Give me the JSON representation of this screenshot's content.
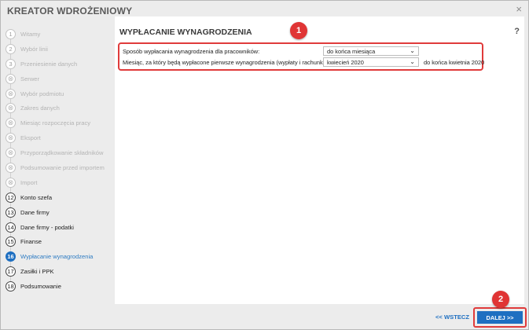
{
  "app": {
    "title": "KREATOR WDROŻENIOWY",
    "close": "×"
  },
  "steps": [
    {
      "num": "1",
      "label": "Witamy",
      "state": "done"
    },
    {
      "num": "2",
      "label": "Wybór linii",
      "state": "done"
    },
    {
      "num": "3",
      "label": "Przeniesienie danych",
      "state": "done"
    },
    {
      "num": "⊗",
      "label": "Serwer",
      "state": "skipped"
    },
    {
      "num": "⊗",
      "label": "Wybór podmiotu",
      "state": "skipped"
    },
    {
      "num": "⊗",
      "label": "Zakres danych",
      "state": "skipped"
    },
    {
      "num": "⊗",
      "label": "Miesiąc rozpoczęcia pracy",
      "state": "skipped"
    },
    {
      "num": "⊗",
      "label": "Eksport",
      "state": "skipped"
    },
    {
      "num": "⊗",
      "label": "Przyporządkowanie składników",
      "state": "skipped"
    },
    {
      "num": "⊗",
      "label": "Podsumowanie przed importem",
      "state": "skipped"
    },
    {
      "num": "⊗",
      "label": "Import",
      "state": "skipped"
    },
    {
      "num": "12",
      "label": "Konto szefa",
      "state": "active"
    },
    {
      "num": "13",
      "label": "Dane firmy",
      "state": "active"
    },
    {
      "num": "14",
      "label": "Dane firmy - podatki",
      "state": "active"
    },
    {
      "num": "15",
      "label": "Finanse",
      "state": "active"
    },
    {
      "num": "16",
      "label": "Wypłacanie wynagrodzenia",
      "state": "current"
    },
    {
      "num": "17",
      "label": "Zasiłki i PPK",
      "state": "active"
    },
    {
      "num": "18",
      "label": "Podsumowanie",
      "state": "active"
    }
  ],
  "main": {
    "title": "WYPŁACANIE WYNAGRODZENIA",
    "help": "?",
    "row1": {
      "label": "Sposób wypłacania wynagrodzenia dla pracowników:",
      "value": "do końca miesiąca"
    },
    "row2": {
      "label": "Miesiąc, za który będą wypłacone pierwsze wynagrodzenia (wypłaty i rachunki):",
      "value": "kwiecień 2020",
      "suffix": "do końca kwietnia 2020"
    }
  },
  "annotations": {
    "badge1": "1",
    "badge2": "2"
  },
  "footer": {
    "back": "<< WSTECZ",
    "next": "DALEJ >>"
  },
  "colors": {
    "accent": "#1e6fc1",
    "highlight": "#e03b3b"
  }
}
